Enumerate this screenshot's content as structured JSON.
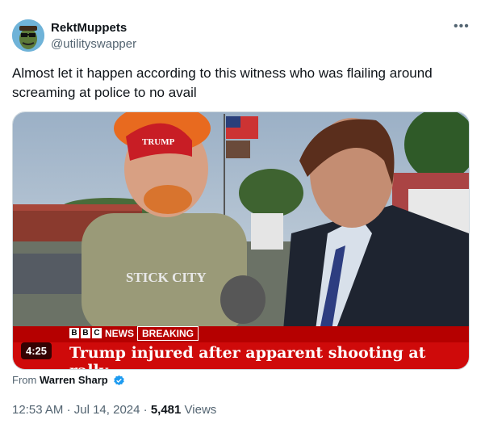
{
  "author": {
    "display_name": "RektMuppets",
    "handle": "@utilityswapper",
    "avatar_icon": "avatar-icon"
  },
  "more_icon": "more-icon",
  "tweet": {
    "text": "Almost let it happen according to this witness who was flailing around screaming at police to no avail"
  },
  "media": {
    "duration": "4:25",
    "chyron_brand": "NEWS",
    "chyron_tag": "BREAKING",
    "headline": "Trump injured after apparent shooting at rally",
    "hat_text": "TRUMP",
    "shirt_text": "STICK CITY",
    "banner_text": "TRUMP"
  },
  "source": {
    "prefix": "From",
    "name": "Warren Sharp",
    "verified_icon": "verified-badge-icon"
  },
  "meta": {
    "time": "12:53 AM",
    "date": "Jul 14, 2024",
    "separator": "·",
    "views_count": "5,481",
    "views_label": "Views"
  },
  "colors": {
    "bbc_red": "#cf0a0a",
    "verified_blue": "#1d9bf0",
    "text_primary": "#0f1419",
    "text_secondary": "#536471"
  }
}
